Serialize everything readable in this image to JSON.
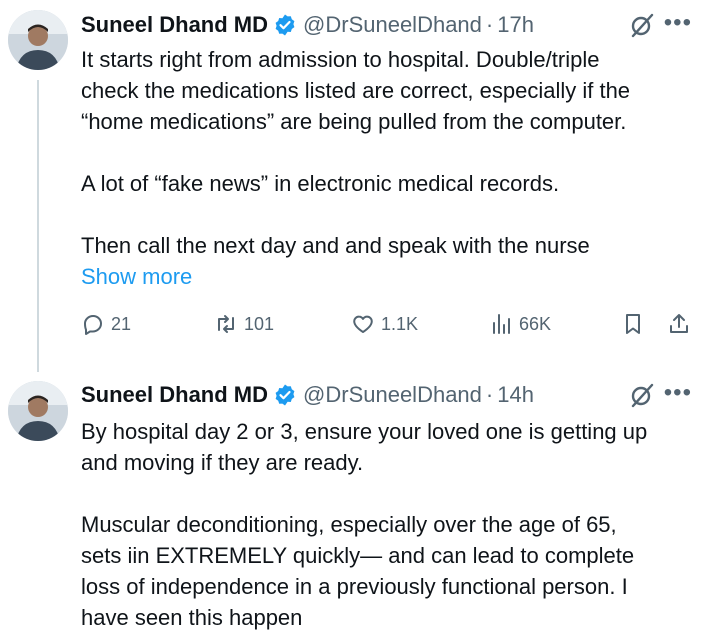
{
  "tweets": [
    {
      "author": "Suneel Dhand MD",
      "handle": "@DrSuneelDhand",
      "separator": "·",
      "time": "17h",
      "text": "It starts right from admission to hospital. Double/triple\ncheck the medications listed are correct, especially if the\n“home medications” are being pulled from the computer.\n\nA lot of “fake news” in electronic medical records.\n\nThen call the next day and and speak with the nurse",
      "show_more": "Show more",
      "replies": "21",
      "reposts": "101",
      "likes": "1.1K",
      "views": "66K"
    },
    {
      "author": "Suneel Dhand MD",
      "handle": "@DrSuneelDhand",
      "separator": "·",
      "time": "14h",
      "text": "By hospital day 2 or 3, ensure your loved one is getting up\nand moving if they are ready.\n\nMuscular deconditioning, especially over the age of 65,\nsets iin EXTREMELY quickly— and can lead to complete\nloss of independence in a previously functional person. I\nhave seen this happen"
    }
  ],
  "colors": {
    "link": "#1d9bf0",
    "secondary_text": "#536471",
    "verified_badge": "#1d9bf0"
  },
  "icons": [
    "verified-badge-icon",
    "grok-icon",
    "more-icon",
    "reply-icon",
    "repost-icon",
    "like-icon",
    "views-icon",
    "bookmark-icon",
    "share-icon"
  ]
}
